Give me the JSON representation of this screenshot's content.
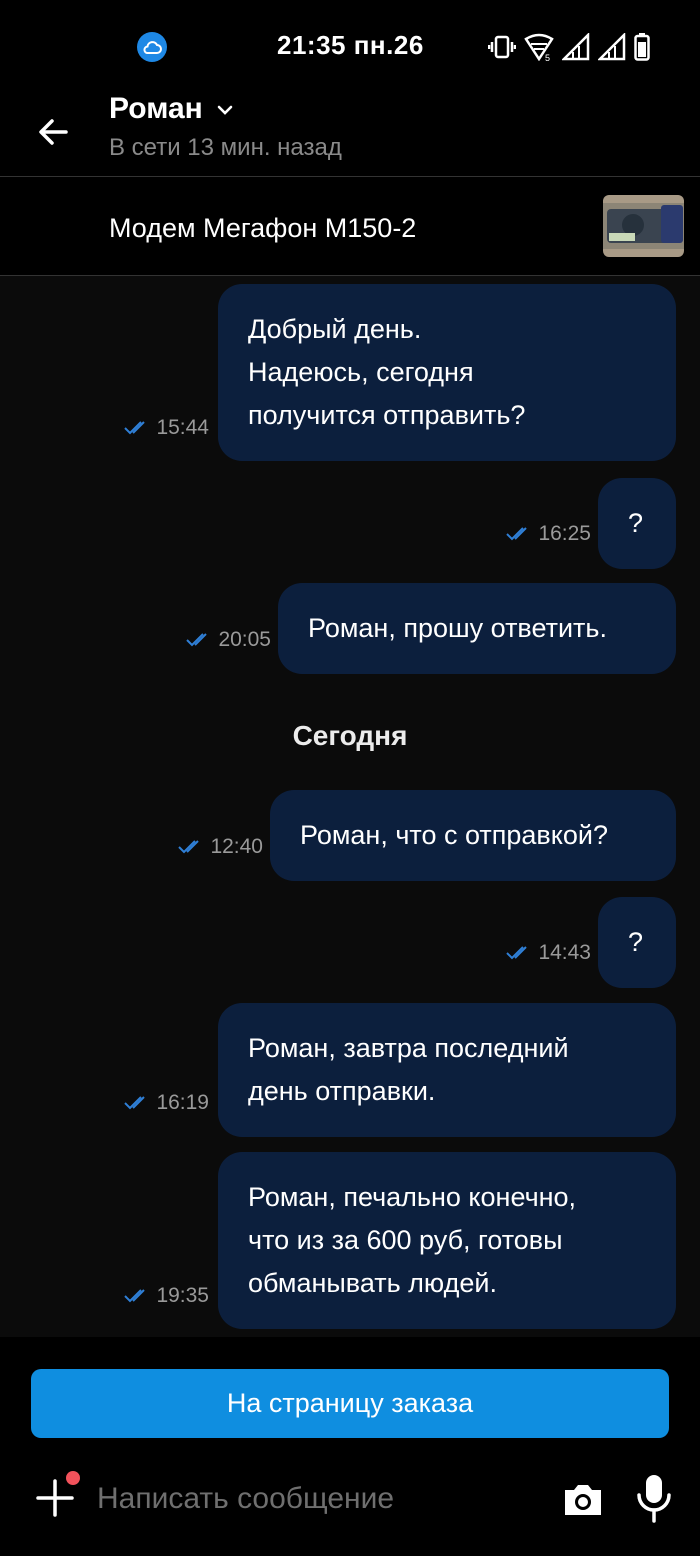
{
  "status_bar": {
    "time": "21:35 пн.26"
  },
  "header": {
    "contact_name": "Роман",
    "presence": "В сети 13 мин. назад"
  },
  "product": {
    "title": "Модем Мегафон М150-2"
  },
  "messages": [
    {
      "text": "Добрый день.\nНадеюсь, сегодня\nполучится отправить?",
      "time": "15:44"
    },
    {
      "text": "?",
      "time": "16:25"
    },
    {
      "text": "Роман, прошу ответить.",
      "time": "20:05"
    },
    {
      "text": "Роман, что с отправкой?",
      "time": "12:40"
    },
    {
      "text": "?",
      "time": "14:43"
    },
    {
      "text": "Роман, завтра последний\nдень отправки.",
      "time": "16:19"
    },
    {
      "text": "Роман, печально конечно,\nчто из за 600 руб, готовы\nобманывать людей.",
      "time": "19:35"
    }
  ],
  "day_separator": "Сегодня",
  "footer": {
    "order_button": "На страницу заказа",
    "input_placeholder": "Написать сообщение"
  },
  "colors": {
    "bubble": "#0c1f3d",
    "accent": "#0f8ee0",
    "read_check": "#2f7fd6",
    "notification_dot": "#f2525b"
  }
}
